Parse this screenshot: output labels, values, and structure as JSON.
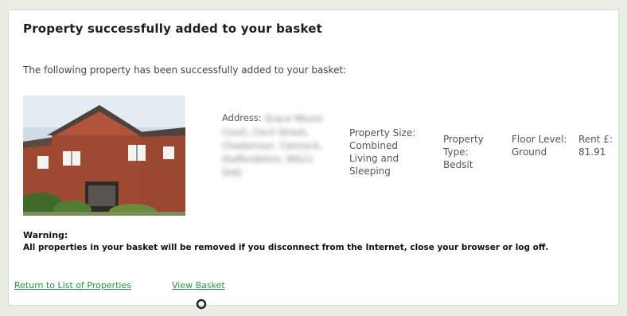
{
  "page": {
    "title": "Property successfully added to your basket",
    "intro": "The following property has been successfully added to your basket:"
  },
  "property": {
    "address_label": "Address:",
    "address_value": "Grace Moore Court, Cecil Street, Chadsmoor, Cannock, Staffordshire, WS11 5HG",
    "size_label": "Property Size:",
    "size_value": "Combined Living and Sleeping",
    "type_label": "Property Type:",
    "type_value": "Bedsit",
    "floor_label": "Floor Level:",
    "floor_value": "Ground",
    "rent_label": "Rent £:",
    "rent_value": "81.91"
  },
  "warning": {
    "title": "Warning:",
    "text": "All properties in your basket will be removed if you disconnect from the Internet, close your browser or log off."
  },
  "links": {
    "return": "Return to List of Properties",
    "basket": "View Basket"
  },
  "colors": {
    "background": "#e9efe4",
    "panel": "#ffffff",
    "link": "#2f8a4d",
    "building_brick": "#a14a33"
  }
}
